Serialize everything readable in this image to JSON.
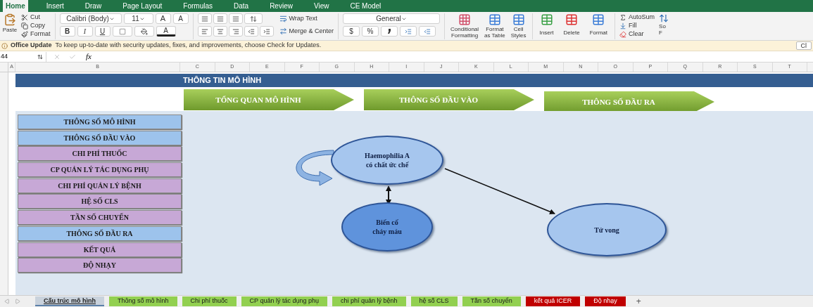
{
  "ribbon_tabs": [
    {
      "label": "Home",
      "selected": true
    },
    {
      "label": "Insert",
      "selected": false
    },
    {
      "label": "Draw",
      "selected": false
    },
    {
      "label": "Page Layout",
      "selected": false
    },
    {
      "label": "Formulas",
      "selected": false
    },
    {
      "label": "Data",
      "selected": false
    },
    {
      "label": "Review",
      "selected": false
    },
    {
      "label": "View",
      "selected": false
    },
    {
      "label": "CE Model",
      "selected": false
    }
  ],
  "ribbon": {
    "clipboard": {
      "paste": "Paste",
      "cut": "Cut",
      "copy": "Copy",
      "format": "Format"
    },
    "font": {
      "name": "Calibri (Body)",
      "size": "11",
      "grow": "A",
      "shrink": "A",
      "bold": "B",
      "italic": "I",
      "underline": "U",
      "color_letter": "A"
    },
    "alignment": {
      "wrap": "Wrap Text",
      "merge": "Merge & Center"
    },
    "number": {
      "format": "General",
      "currency": "$",
      "percent": "%"
    },
    "styles": [
      {
        "lines": [
          "Conditional",
          "Formatting"
        ]
      },
      {
        "lines": [
          "Format",
          "as Table"
        ]
      },
      {
        "lines": [
          "Cell",
          "Styles"
        ]
      }
    ],
    "cells": [
      "Insert",
      "Delete",
      "Format"
    ],
    "editing": {
      "autosum": "AutoSum",
      "fill": "Fill",
      "clear": "Clear",
      "sort": [
        "So",
        "F"
      ]
    }
  },
  "update_bar": {
    "title": "Office Update",
    "message": "To keep up-to-date with security updates, fixes, and improvements, choose Check for Updates.",
    "button": "Cl"
  },
  "formula_bar": {
    "name_box": "44",
    "fx": "fx"
  },
  "columns": [
    "A",
    "B",
    "C",
    "D",
    "E",
    "F",
    "G",
    "H",
    "I",
    "J",
    "K",
    "L",
    "M",
    "N",
    "O",
    "P",
    "Q",
    "R",
    "S",
    "T"
  ],
  "sheet": {
    "title": "THÔNG TIN MÔ HÌNH",
    "nav_arrows": [
      "TỔNG QUAN MÔ HÌNH",
      "THÔNG SỐ ĐẦU VÀO",
      "THÔNG SỐ ĐẦU RA"
    ],
    "menu": [
      {
        "label": "THÔNG SỐ MÔ HÌNH",
        "color": "#9dc3ec"
      },
      {
        "label": "THÔNG SỐ ĐẦU VÀO",
        "color": "#9dc3ec"
      },
      {
        "label": "CHI PHÍ THUỐC",
        "color": "#c7a8d6"
      },
      {
        "label": "CP QUẢN LÝ TÁC DỤNG PHỤ",
        "color": "#c7a8d6"
      },
      {
        "label": "CHI PHÍ QUẢN LÝ BỆNH",
        "color": "#c7a8d6"
      },
      {
        "label": "HỆ SỐ CLS",
        "color": "#c7a8d6"
      },
      {
        "label": "TẦN SỐ CHUYỂN",
        "color": "#c7a8d6"
      },
      {
        "label": "THÔNG SỐ ĐẦU RA",
        "color": "#9dc3ec"
      },
      {
        "label": "KẾT QUẢ",
        "color": "#c7a8d6"
      },
      {
        "label": "ĐỘ NHẠY",
        "color": "#c7a8d6"
      }
    ],
    "diagram": {
      "nodes": [
        {
          "lines": [
            "Haemophilia A",
            "có chất ức chế"
          ],
          "color": "#a6c6ee"
        },
        {
          "lines": [
            "Biến cố",
            "chảy máu"
          ],
          "color": "#5f93dc"
        },
        {
          "lines": [
            "Tử vong"
          ],
          "color": "#a6c6ee"
        }
      ]
    }
  },
  "sheet_tabs": [
    {
      "label": "Cấu trúc mô hình",
      "color": "#c9d2dc",
      "selected": true
    },
    {
      "label": "Thông số mô hình",
      "color": "#92d050",
      "selected": false
    },
    {
      "label": "Chi phí thuốc",
      "color": "#92d050",
      "selected": false
    },
    {
      "label": "CP quản lý tác dụng phụ",
      "color": "#92d050",
      "selected": false
    },
    {
      "label": "chi phí quản lý bệnh",
      "color": "#92d050",
      "selected": false
    },
    {
      "label": "hệ số CLS",
      "color": "#92d050",
      "selected": false
    },
    {
      "label": "Tần số chuyển",
      "color": "#92d050",
      "selected": false
    },
    {
      "label": "kết quả ICER",
      "color": "#c00000",
      "selected": false
    },
    {
      "label": "Độ nhạy",
      "color": "#c00000",
      "selected": false
    }
  ],
  "add_sheet": "+"
}
